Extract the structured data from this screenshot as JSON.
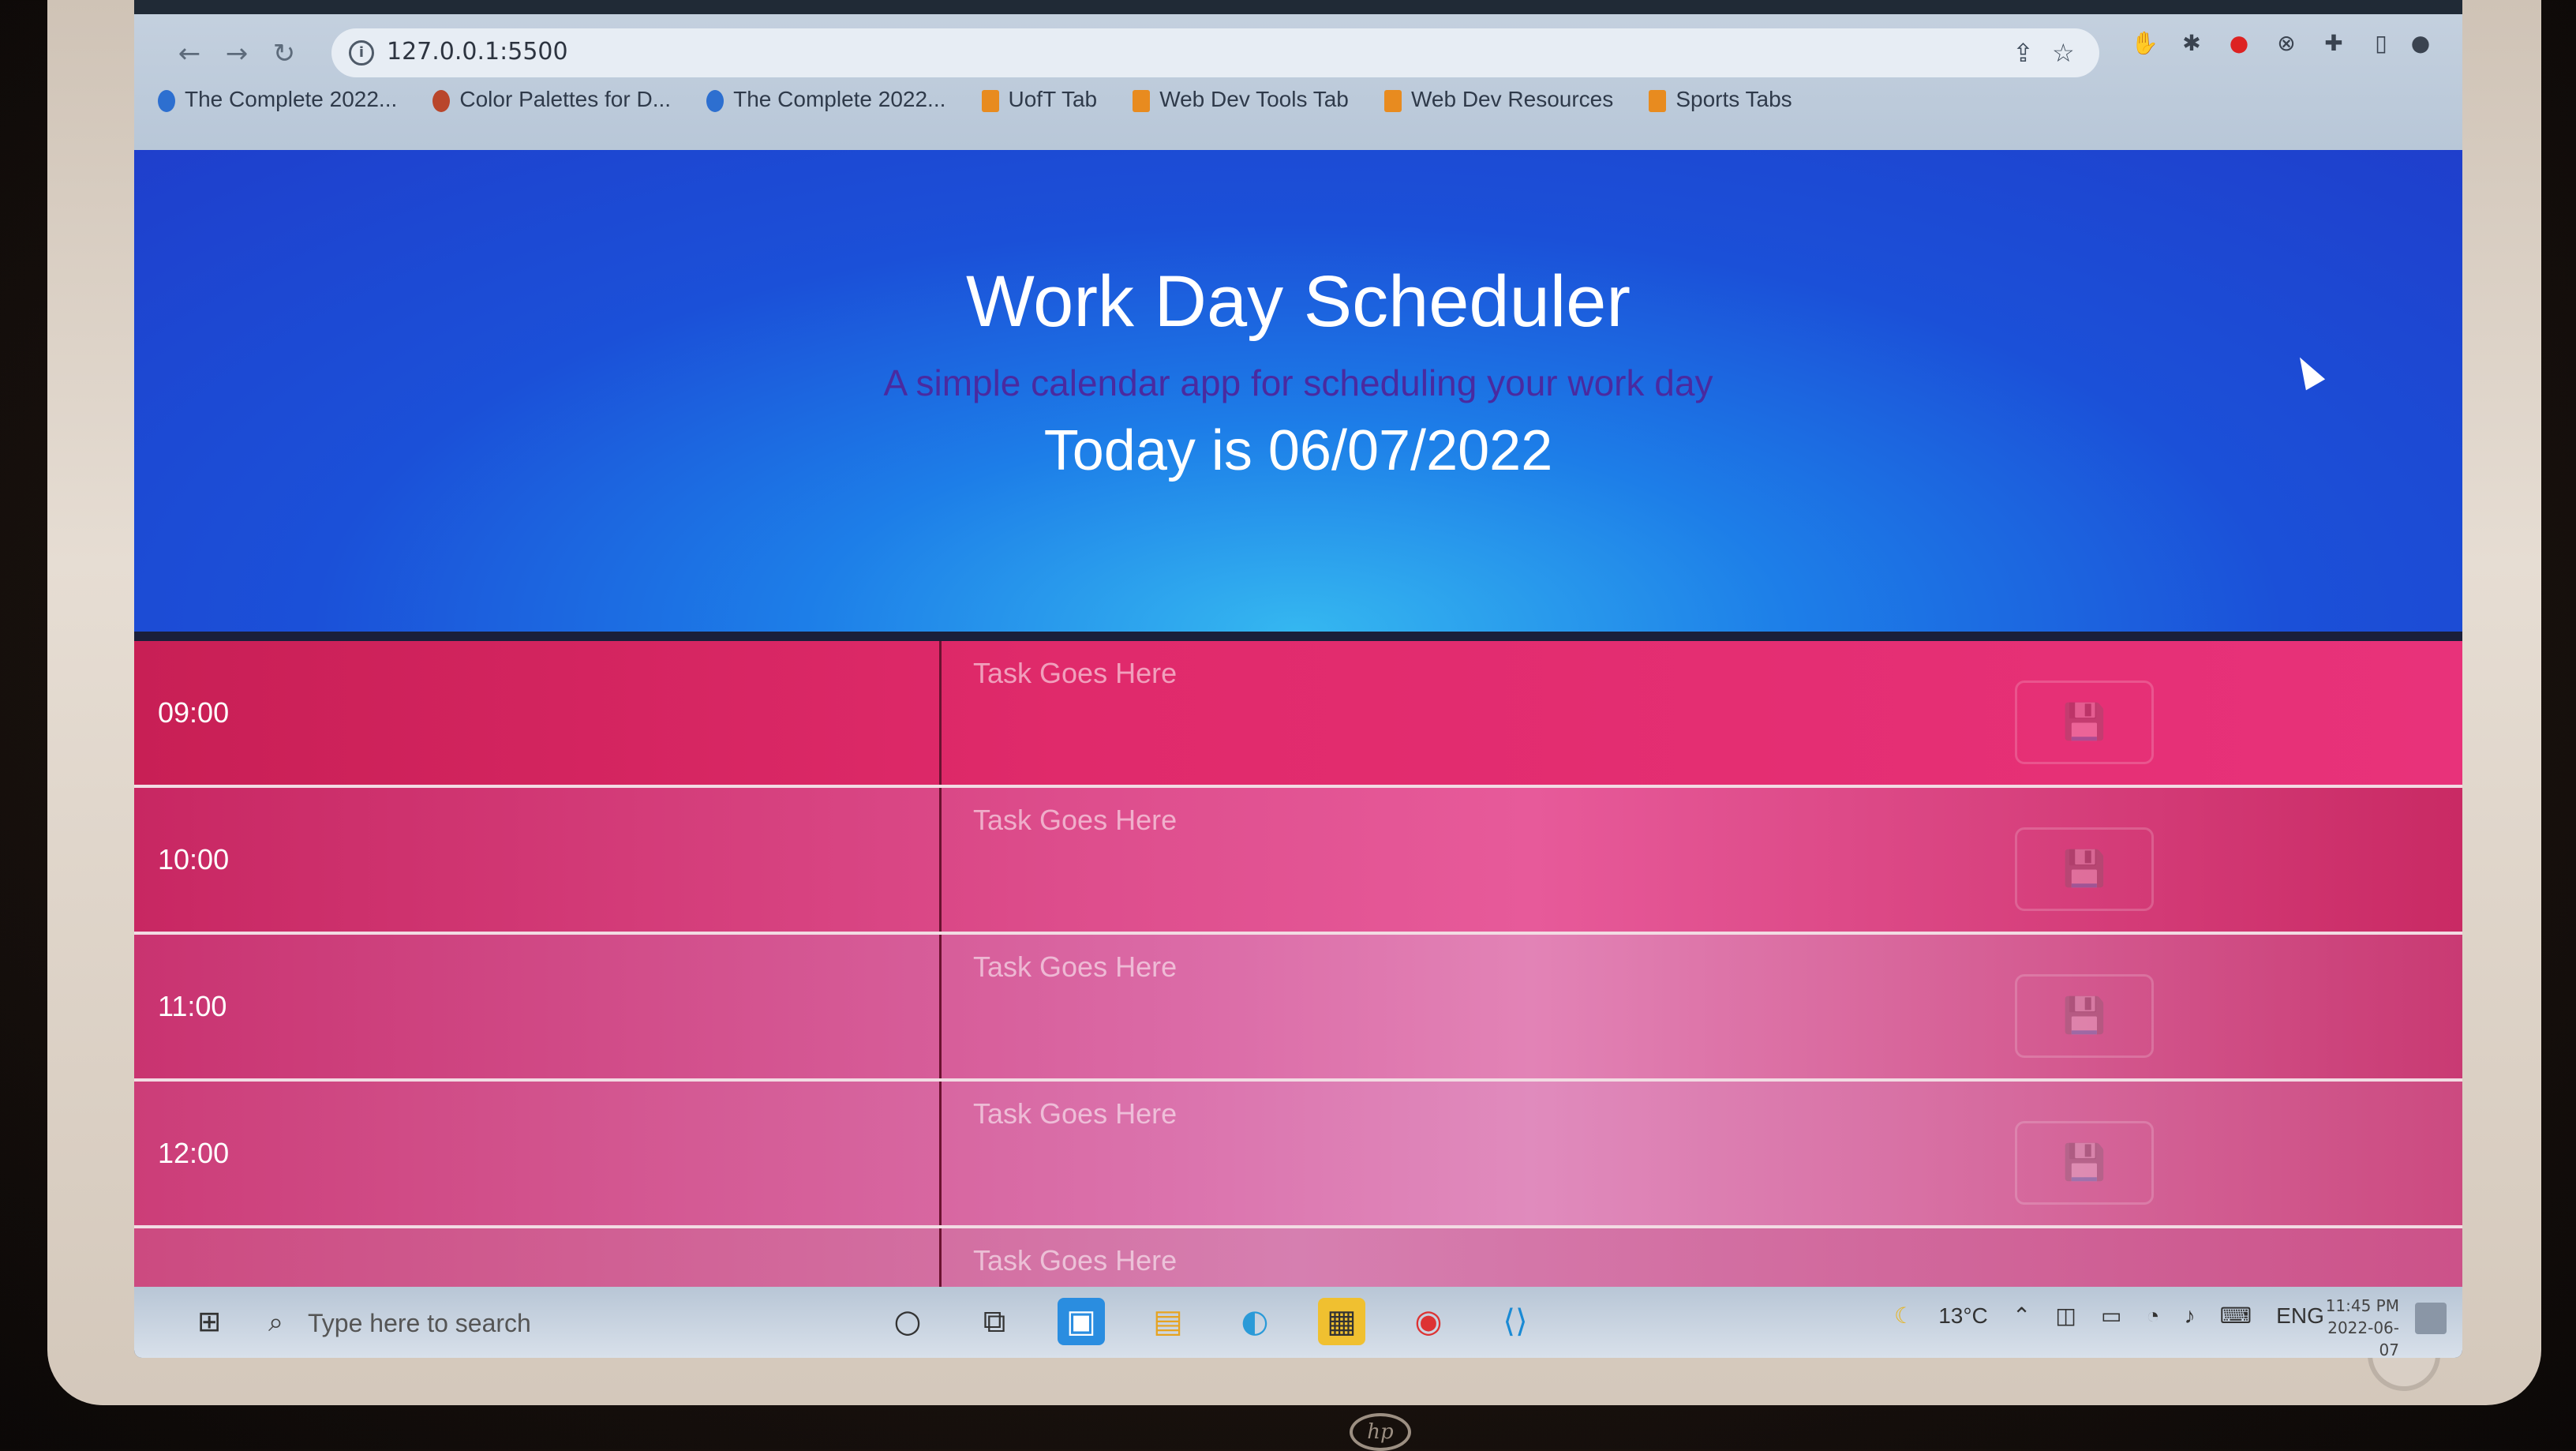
{
  "browser": {
    "url": "127.0.0.1:5500",
    "bookmarks": [
      {
        "label": "The Complete 2022...",
        "icon": "udemy-icon"
      },
      {
        "label": "Color Palettes for D...",
        "icon": "palette-icon"
      },
      {
        "label": "The Complete 2022...",
        "icon": "udemy-icon"
      },
      {
        "label": "UofT Tab",
        "icon": "folder-icon"
      },
      {
        "label": "Web Dev Tools Tab",
        "icon": "folder-icon"
      },
      {
        "label": "Web Dev Resources",
        "icon": "folder-icon"
      },
      {
        "label": "Sports Tabs",
        "icon": "folder-icon"
      }
    ]
  },
  "header": {
    "title": "Work Day Scheduler",
    "subtitle": "A simple calendar app for scheduling your work day",
    "date_text": "Today is 06/07/2022"
  },
  "schedule": {
    "placeholder": "Task Goes Here",
    "rows": [
      {
        "hour": "09:00"
      },
      {
        "hour": "10:00"
      },
      {
        "hour": "11:00"
      },
      {
        "hour": "12:00"
      },
      {
        "hour": ""
      }
    ],
    "save_icon": "floppy-disk-icon"
  },
  "taskbar": {
    "search_placeholder": "Type here to search",
    "temperature": "13°C",
    "language": "ENG",
    "time": "11:45 PM",
    "date": "2022-06-07"
  },
  "colors": {
    "header_blue": "#1d6fe6",
    "row_pink": "#e02a6b",
    "title_white": "#ffffff",
    "subtitle_purple": "#4a2aa0"
  }
}
